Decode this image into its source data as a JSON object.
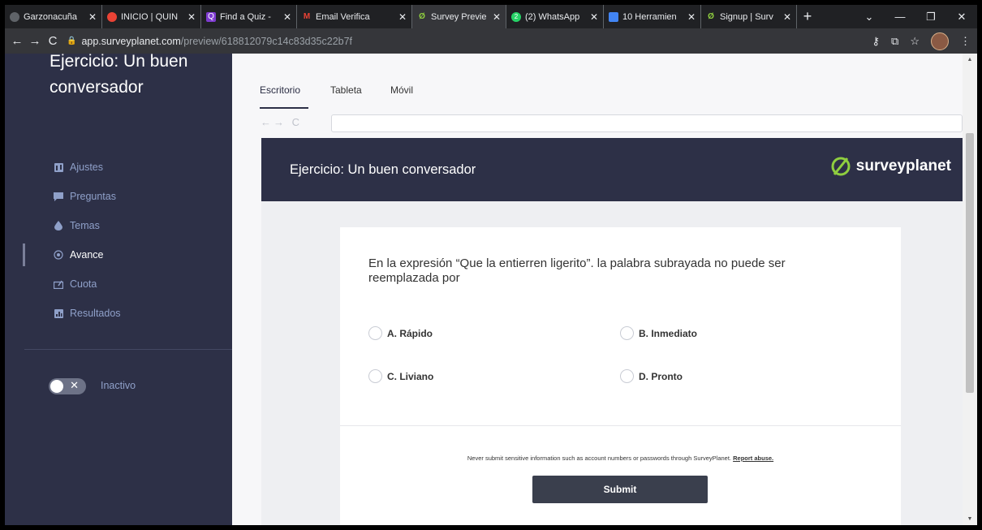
{
  "browser": {
    "tabs": [
      {
        "label": "Garzonacuña",
        "icon": "chrome-icon",
        "color": "#9aa0a6"
      },
      {
        "label": "INICIO | QUIN",
        "icon": "quinto-icon",
        "color": "#ea4335"
      },
      {
        "label": "Find a Quiz -",
        "icon": "quizizz-icon",
        "color": "#7e3bd0"
      },
      {
        "label": "Email Verifica",
        "icon": "gmail-icon",
        "color": "#ea4335"
      },
      {
        "label": "Survey Previe",
        "icon": "surveyplanet-icon",
        "color": "#8fce3f",
        "active": true
      },
      {
        "label": "(2) WhatsApp",
        "icon": "whatsapp-icon",
        "color": "#25d366"
      },
      {
        "label": "10 Herramien",
        "icon": "article-icon",
        "color": "#4285f4"
      },
      {
        "label": "Signup | Surv",
        "icon": "surveyplanet-icon",
        "color": "#8fce3f"
      }
    ],
    "url_host": "app.surveyplanet.com",
    "url_path": "/preview/618812079c14c83d35c22b7f"
  },
  "sidebar": {
    "title": "Ejercicio: Un buen conversador",
    "items": [
      {
        "label": "Ajustes",
        "icon": "settings-icon"
      },
      {
        "label": "Preguntas",
        "icon": "chat-icon"
      },
      {
        "label": "Temas",
        "icon": "drop-icon"
      },
      {
        "label": "Avance",
        "icon": "target-icon",
        "active": true
      },
      {
        "label": "Cuota",
        "icon": "quota-icon"
      },
      {
        "label": "Resultados",
        "icon": "chart-icon"
      }
    ],
    "toggle_label": "Inactivo",
    "toggle_state": "off"
  },
  "preview_tabs": [
    "Escritorio",
    "Tableta",
    "Móvil"
  ],
  "survey": {
    "header_title": "Ejercicio: Un buen conversador",
    "logo_text": "surveyplanet",
    "question": "En la expresión “Que la entierren ligerito”. la palabra subrayada no puede ser reemplazada por",
    "options": [
      "A. Rápido",
      "B. Inmediato",
      "C. Liviano",
      "D. Pronto"
    ],
    "disclaimer": "Never submit sensitive information such as account numbers or passwords through SurveyPlanet.",
    "report_link": "Report abuse.",
    "submit_label": "Submit"
  },
  "colors": {
    "sidebar_bg": "#2d3047",
    "accent": "#8fce3f",
    "submit_bg": "#3a3f4d"
  }
}
